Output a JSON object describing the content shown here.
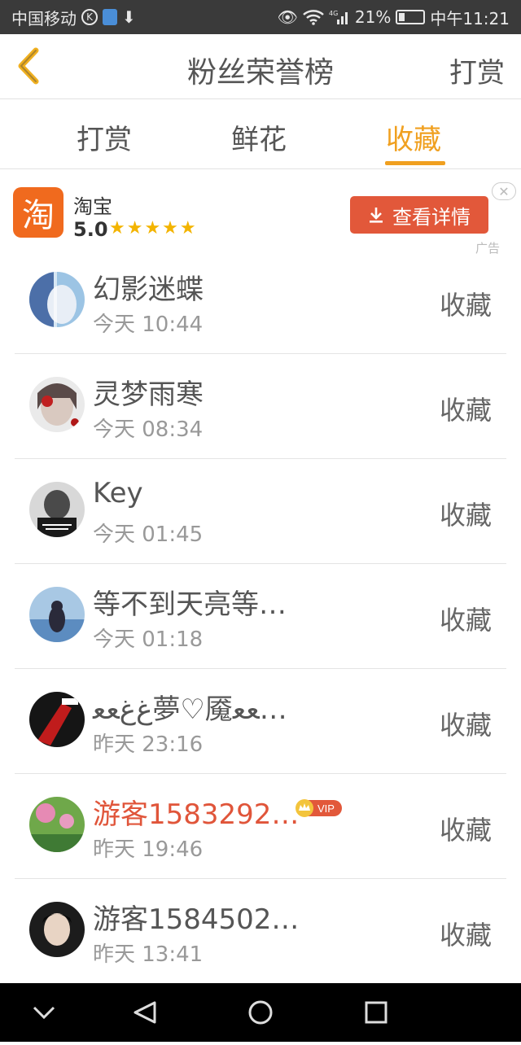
{
  "status_bar": {
    "carrier": "中国移动",
    "network": "4G",
    "battery": "21%",
    "time": "中午11:21"
  },
  "header": {
    "title": "粉丝荣誉榜",
    "right_action": "打赏"
  },
  "tabs": [
    {
      "label": "打赏",
      "active": false
    },
    {
      "label": "鲜花",
      "active": false
    },
    {
      "label": "收藏",
      "active": true
    }
  ],
  "ad": {
    "logo_char": "淘",
    "app_name": "淘宝",
    "rating": "5.0",
    "stars": "★★★★★",
    "button_label": "查看详情",
    "close": "✕",
    "label": "广告"
  },
  "list": [
    {
      "name": "幻影迷蝶",
      "time": "今天 10:44",
      "action": "收藏"
    },
    {
      "name": "灵梦雨寒",
      "time": "今天 08:34",
      "action": "收藏"
    },
    {
      "name": "Key",
      "time": "今天 01:45",
      "action": "收藏"
    },
    {
      "name": "等不到天亮等…",
      "time": "今天 01:18",
      "action": "收藏"
    },
    {
      "name": "ﻍﻍﻌﻌ夢♡魇ﻌﻌ…",
      "time": "昨天 23:16",
      "action": "收藏"
    },
    {
      "name": "游客1583292…",
      "time": "昨天 19:46",
      "action": "收藏",
      "vip": "VIP"
    },
    {
      "name": "游客1584502…",
      "time": "昨天 13:41",
      "action": "收藏"
    }
  ],
  "colors": {
    "accent": "#f0a020",
    "ad_button": "#e2583a",
    "vip_name": "#e0553a",
    "status_bar": "#3a3a3a"
  }
}
